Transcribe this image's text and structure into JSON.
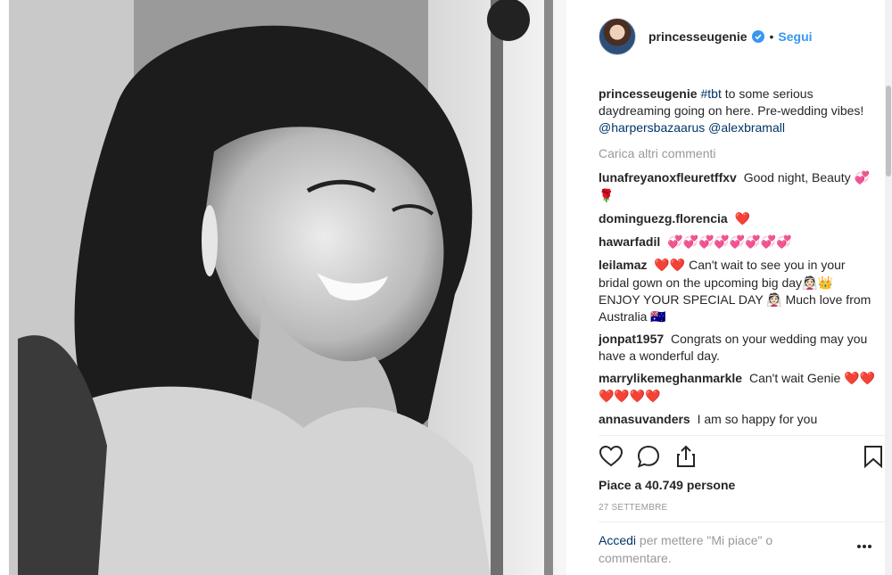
{
  "post": {
    "username": "princesseugenie",
    "follow_label": "Segui",
    "separator": "•",
    "caption": {
      "username": "princesseugenie",
      "hashtag": "#tbt",
      "text": "to some serious daydreaming going on here. Pre-wedding vibes!",
      "mention1": "@harpersbazaarus",
      "mention2": "@alexbramall"
    },
    "load_more": "Carica altri commenti",
    "comments": [
      {
        "user": "lunafreyanoxfleuretffxv",
        "text": "Good night, Beauty",
        "emoji": "💞🌹"
      },
      {
        "user": "dominguezg.florencia",
        "text": "",
        "emoji": "❤️"
      },
      {
        "user": "hawarfadil",
        "text": "",
        "emoji": "💞💞💞💞💞💞💞💞"
      },
      {
        "user": "leilamaz",
        "emoji_lead": "❤️❤️",
        "text": "Can't wait to see you in your bridal gown on the upcoming big day👰🏻👑 ENJOY YOUR SPECIAL DAY 👰🏻 Much love from Australia 🇦🇺"
      },
      {
        "user": "jonpat1957",
        "text": "Congrats on your wedding may you have a wonderful day.",
        "emoji": ""
      },
      {
        "user": "marrylikemeghanmarkle",
        "text": "Can't wait Genie",
        "emoji": "❤️❤️❤️❤️❤️❤️"
      },
      {
        "user": "annasuvanders",
        "text": "I am so happy for you",
        "emoji": ""
      }
    ],
    "likes": "Piace a 40.749 persone",
    "date": "27 SETTEMBRE",
    "login_link": "Accedi",
    "login_text": "per mettere \"Mi piace\" o commentare.",
    "icons": [
      "heart-icon",
      "comment-icon",
      "share-icon",
      "bookmark-icon",
      "more-options-icon",
      "verified-badge-icon"
    ],
    "colors": {
      "link": "#003569",
      "follow": "#3897f0",
      "muted": "#999999",
      "text": "#262626"
    }
  }
}
